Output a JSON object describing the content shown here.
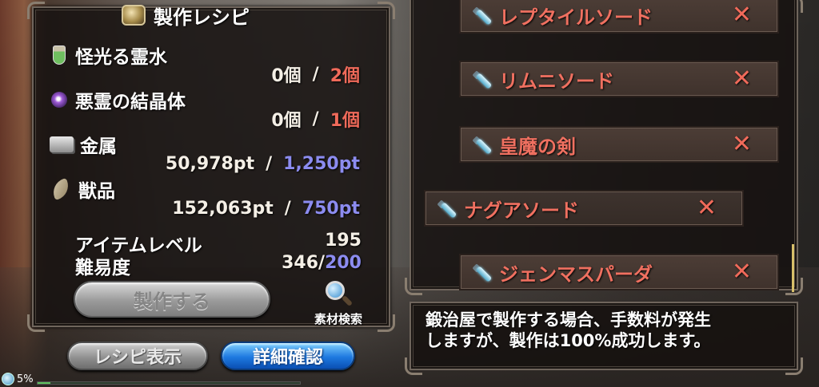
{
  "panel": {
    "title": "製作レシピ",
    "title_icon": "forge-icon"
  },
  "materials": [
    {
      "name": "怪光る霊水",
      "icon": "bottle-icon",
      "have": "0個",
      "sep": "/",
      "need": "2個",
      "need_color": "#f06a5a"
    },
    {
      "name": "悪霊の結晶体",
      "icon": "crystal-icon",
      "have": "0個",
      "sep": "/",
      "need": "1個",
      "need_color": "#f06a5a"
    },
    {
      "name": "金属",
      "icon": "metal-icon",
      "have": "50,978pt",
      "sep": "/",
      "need": "1,250pt",
      "need_color": "#8c8cf0"
    },
    {
      "name": "獣品",
      "icon": "fang-icon",
      "have": "152,063pt",
      "sep": "/",
      "need": "750pt",
      "need_color": "#8c8cf0"
    }
  ],
  "stats": {
    "item_level_label": "アイテムレベル",
    "item_level_value": "195",
    "difficulty_label": "難易度",
    "difficulty_current": "346/",
    "difficulty_max": "200"
  },
  "buttons": {
    "craft": "製作する",
    "search": "素材検索",
    "recipe": "レシピ表示",
    "detail": "詳細確認"
  },
  "status": {
    "percent": "5%",
    "progress": 0.05
  },
  "weapons": [
    {
      "name": "レプタイルソード",
      "selected": false
    },
    {
      "name": "リムニソード",
      "selected": false
    },
    {
      "name": "皇魔の剣",
      "selected": false
    },
    {
      "name": "ナグアソード",
      "selected": true
    },
    {
      "name": "ジェンマスパーダ",
      "selected": false
    }
  ],
  "message": {
    "line1": "鍛治屋で製作する場合、手数料が発生",
    "line2": "しますが、製作は100%成功します。"
  },
  "colors": {
    "accent_red": "#f06a5a",
    "accent_blue": "#8c8cf0",
    "detail_button": "#1e79e0"
  }
}
